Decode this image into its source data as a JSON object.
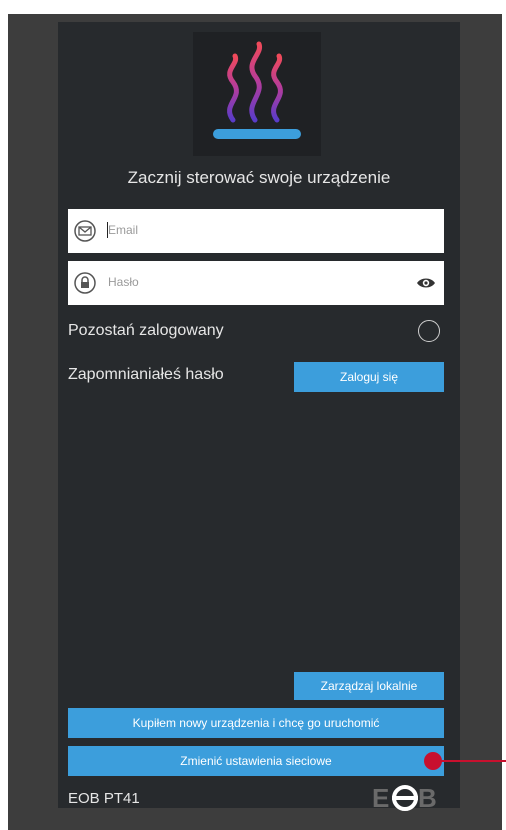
{
  "header": {
    "logo_icon": "heat-waves-logo-icon",
    "title": "Zacznij sterować swoje urządzenie"
  },
  "form": {
    "email": {
      "placeholder": "Email",
      "icon": "envelope-icon"
    },
    "password": {
      "placeholder": "Hasło",
      "icon": "lock-icon",
      "toggle_icon": "eye-icon"
    },
    "remember_label": "Pozostań zalogowany",
    "remember_checked": false,
    "forgot_label": "Zapomnianiałeś hasło",
    "login_button": "Zaloguj się"
  },
  "actions": {
    "manage_local": "Zarządzaj lokalnie",
    "new_device": "Kupiłem nowy urządzenia i chcę go uruchomić",
    "network_settings": "Zmienić ustawienia sieciowe"
  },
  "footer": {
    "device_name": "EOB PT41",
    "brand_logo": "eob-logo"
  },
  "colors": {
    "accent": "#3c9edc",
    "background": "#272a2d",
    "marker": "#c8102e"
  }
}
